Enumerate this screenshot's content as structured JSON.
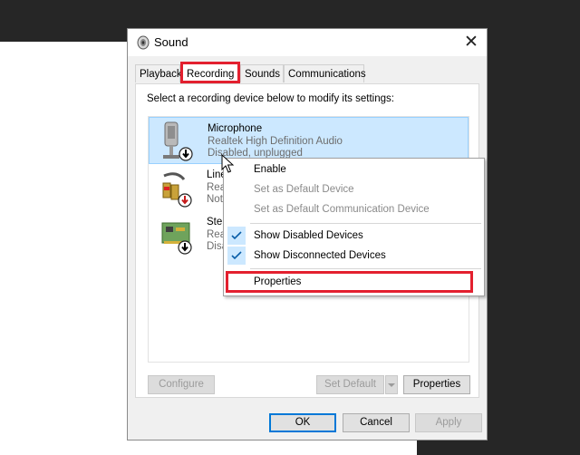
{
  "window": {
    "title": "Sound",
    "close_glyph": "✕"
  },
  "tabs": [
    {
      "label": "Playback",
      "active": false
    },
    {
      "label": "Recording",
      "active": true
    },
    {
      "label": "Sounds",
      "active": false
    },
    {
      "label": "Communications",
      "active": false
    }
  ],
  "instruction": "Select a recording device below to modify its settings:",
  "devices": [
    {
      "name": "Microphone",
      "line1": "Realtek High Definition Audio",
      "line2": "Disabled, unplugged",
      "icon": "microphone-icon",
      "selected": true
    },
    {
      "name": "Line",
      "line1": "Rea",
      "line2": "Not",
      "icon": "line-in-jack-icon",
      "selected": false
    },
    {
      "name": "Ster",
      "line1": "Rea",
      "line2": "Disa",
      "icon": "sound-card-icon",
      "selected": false
    }
  ],
  "buttons": {
    "configure": "Configure",
    "set_default": "Set Default",
    "properties": "Properties",
    "ok": "OK",
    "cancel": "Cancel",
    "apply": "Apply"
  },
  "context_menu": {
    "items": [
      {
        "label": "Enable",
        "disabled": false,
        "checked": false
      },
      {
        "label": "Set as Default Device",
        "disabled": true,
        "checked": false
      },
      {
        "label": "Set as Default Communication Device",
        "disabled": true,
        "checked": false
      },
      {
        "label": "Show Disabled Devices",
        "disabled": false,
        "checked": true
      },
      {
        "label": "Show Disconnected Devices",
        "disabled": false,
        "checked": true
      },
      {
        "label": "Properties",
        "disabled": false,
        "checked": false,
        "highlighted": true
      }
    ]
  },
  "colors": {
    "highlight_red": "#e3202f",
    "selection_blue": "#cce8ff",
    "accent_blue": "#0078d7",
    "dark_background": "#262626"
  }
}
